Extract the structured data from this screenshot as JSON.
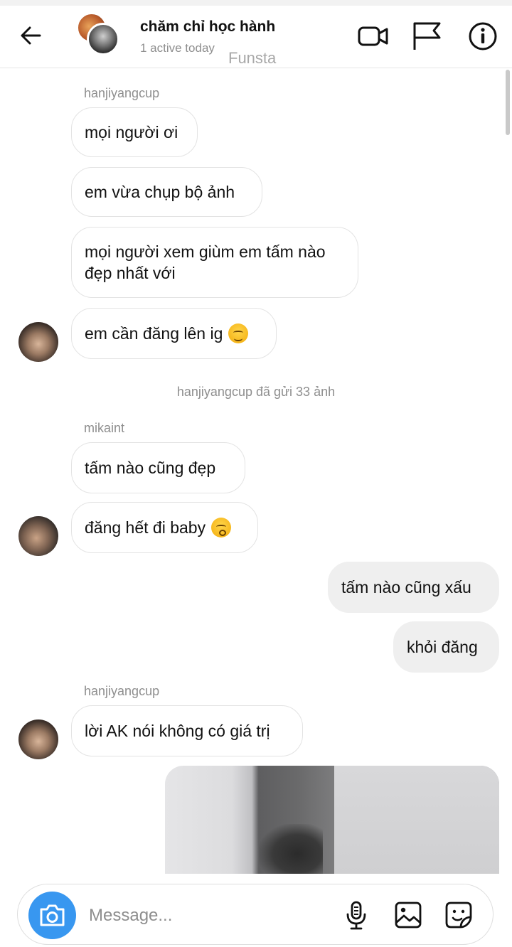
{
  "header": {
    "title": "chăm chỉ học hành",
    "status": "1 active today",
    "overlay_text": "Funsta",
    "icons": [
      "back-arrow-icon",
      "video-call-icon",
      "flag-icon",
      "info-icon"
    ]
  },
  "messages": {
    "group1_sender": "hanjiyangcup",
    "m1": "mọi người ơi",
    "m2": "em vừa chụp bộ ảnh",
    "m3": "mọi người xem giùm em tấm nào đẹp nhất với",
    "m4": "em cần đăng lên ig",
    "system_note": "hanjiyangcup đã gửi 33 ảnh",
    "group2_sender": "mikaint",
    "m5": "tấm nào cũng đẹp",
    "m6": "đăng hết đi baby",
    "me1": "tấm nào cũng xấu",
    "me2": "khỏi đăng",
    "group3_sender": "hanjiyangcup",
    "m7": "lời AK nói không có giá trị"
  },
  "composer": {
    "placeholder": "Message...",
    "icons": [
      "camera-icon",
      "microphone-icon",
      "gallery-icon",
      "sticker-icon"
    ]
  },
  "colors": {
    "accent": "#3897f0",
    "my_bubble": "#efefef",
    "muted_text": "#8e8e8e"
  }
}
